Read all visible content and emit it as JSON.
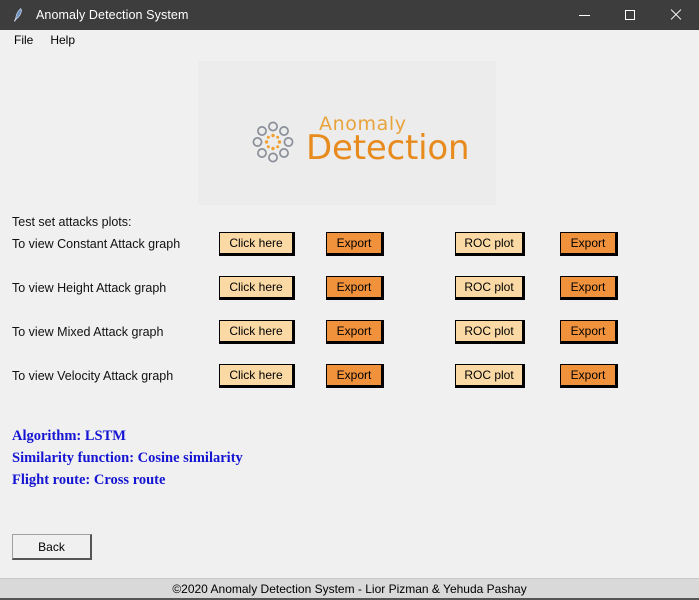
{
  "window": {
    "title": "Anomaly Detection System",
    "icon": "feather-icon",
    "controls": {
      "minimize": "minimize-icon",
      "maximize": "maximize-icon",
      "close": "close-icon"
    }
  },
  "menubar": {
    "items": [
      {
        "label": "File"
      },
      {
        "label": "Help"
      }
    ]
  },
  "logo": {
    "line1": "Anomaly",
    "line2": "Detection",
    "mark_color_outer": "#8a8f99",
    "mark_color_inner": "#f0a030",
    "text_color_top": "#e8a33d",
    "text_color_bottom": "#e88b1e"
  },
  "main": {
    "section_title": "Test set attacks plots:",
    "rows": [
      {
        "label": "To view Constant Attack graph",
        "graph_button": "Click here",
        "graph_export": "Export",
        "roc_button": "ROC plot",
        "roc_export": "Export"
      },
      {
        "label": "To view Height Attack graph",
        "graph_button": "Click here",
        "graph_export": "Export",
        "roc_button": "ROC plot",
        "roc_export": "Export"
      },
      {
        "label": "To view Mixed Attack graph",
        "graph_button": "Click here",
        "graph_export": "Export",
        "roc_button": "ROC plot",
        "roc_export": "Export"
      },
      {
        "label": "To view Velocity Attack graph",
        "graph_button": "Click here",
        "graph_export": "Export",
        "roc_button": "ROC plot",
        "roc_export": "Export"
      }
    ],
    "info": {
      "algorithm": "Algorithm: LSTM",
      "similarity": "Similarity function: Cosine similarity",
      "route": "Flight route: Cross route",
      "color": "#1414d2"
    },
    "back_button": "Back"
  },
  "footer": {
    "text": "©2020 Anomaly Detection System - Lior Pizman & Yehuda Pashay"
  },
  "colors": {
    "titlebar": "#3d3d3d",
    "client": "#f0f0f0",
    "button_light": "#fbd9a5",
    "button_dark": "#f0913c",
    "footer": "#d9d9d9"
  }
}
